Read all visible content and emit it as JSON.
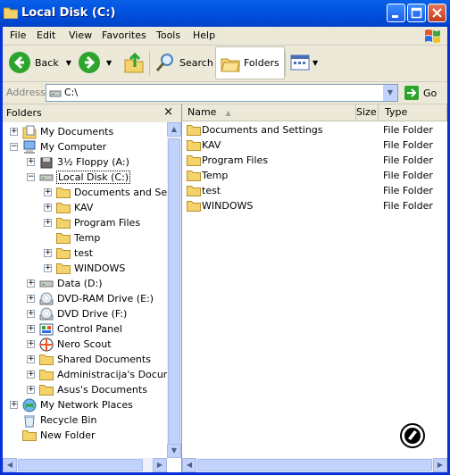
{
  "window": {
    "title": "Local Disk (C:)"
  },
  "menu": [
    "File",
    "Edit",
    "View",
    "Favorites",
    "Tools",
    "Help"
  ],
  "toolbar": {
    "back": "Back",
    "search": "Search",
    "folders": "Folders"
  },
  "address": {
    "label": "Address",
    "value": "C:\\",
    "go": "Go"
  },
  "left_pane": {
    "title": "Folders",
    "close": "×",
    "tree": [
      {
        "label": "My Documents"
      },
      {
        "label": "My Computer"
      },
      {
        "label": "3½ Floppy (A:)"
      },
      {
        "label": "Local Disk (C:)"
      },
      {
        "label": "Documents and Settings"
      },
      {
        "label": "KAV"
      },
      {
        "label": "Program Files"
      },
      {
        "label": "Temp"
      },
      {
        "label": "test"
      },
      {
        "label": "WINDOWS"
      },
      {
        "label": "Data (D:)"
      },
      {
        "label": "DVD-RAM Drive (E:)"
      },
      {
        "label": "DVD Drive (F:)"
      },
      {
        "label": "Control Panel"
      },
      {
        "label": "Nero Scout"
      },
      {
        "label": "Shared Documents"
      },
      {
        "label": "Administracija's Documents"
      },
      {
        "label": "Asus's Documents"
      },
      {
        "label": "My Network Places"
      },
      {
        "label": "Recycle Bin"
      },
      {
        "label": "New Folder"
      }
    ]
  },
  "right_pane": {
    "columns": {
      "name": "Name",
      "size": "Size",
      "type": "Type"
    },
    "files": [
      {
        "name": "Documents and Settings",
        "type": "File Folder"
      },
      {
        "name": "KAV",
        "type": "File Folder"
      },
      {
        "name": "Program Files",
        "type": "File Folder"
      },
      {
        "name": "Temp",
        "type": "File Folder"
      },
      {
        "name": "test",
        "type": "File Folder"
      },
      {
        "name": "WINDOWS",
        "type": "File Folder"
      }
    ]
  },
  "colors": {
    "title_blue": "#0054e3",
    "frame": "#ece9d8",
    "folder_yellow": "#f5d36b"
  }
}
